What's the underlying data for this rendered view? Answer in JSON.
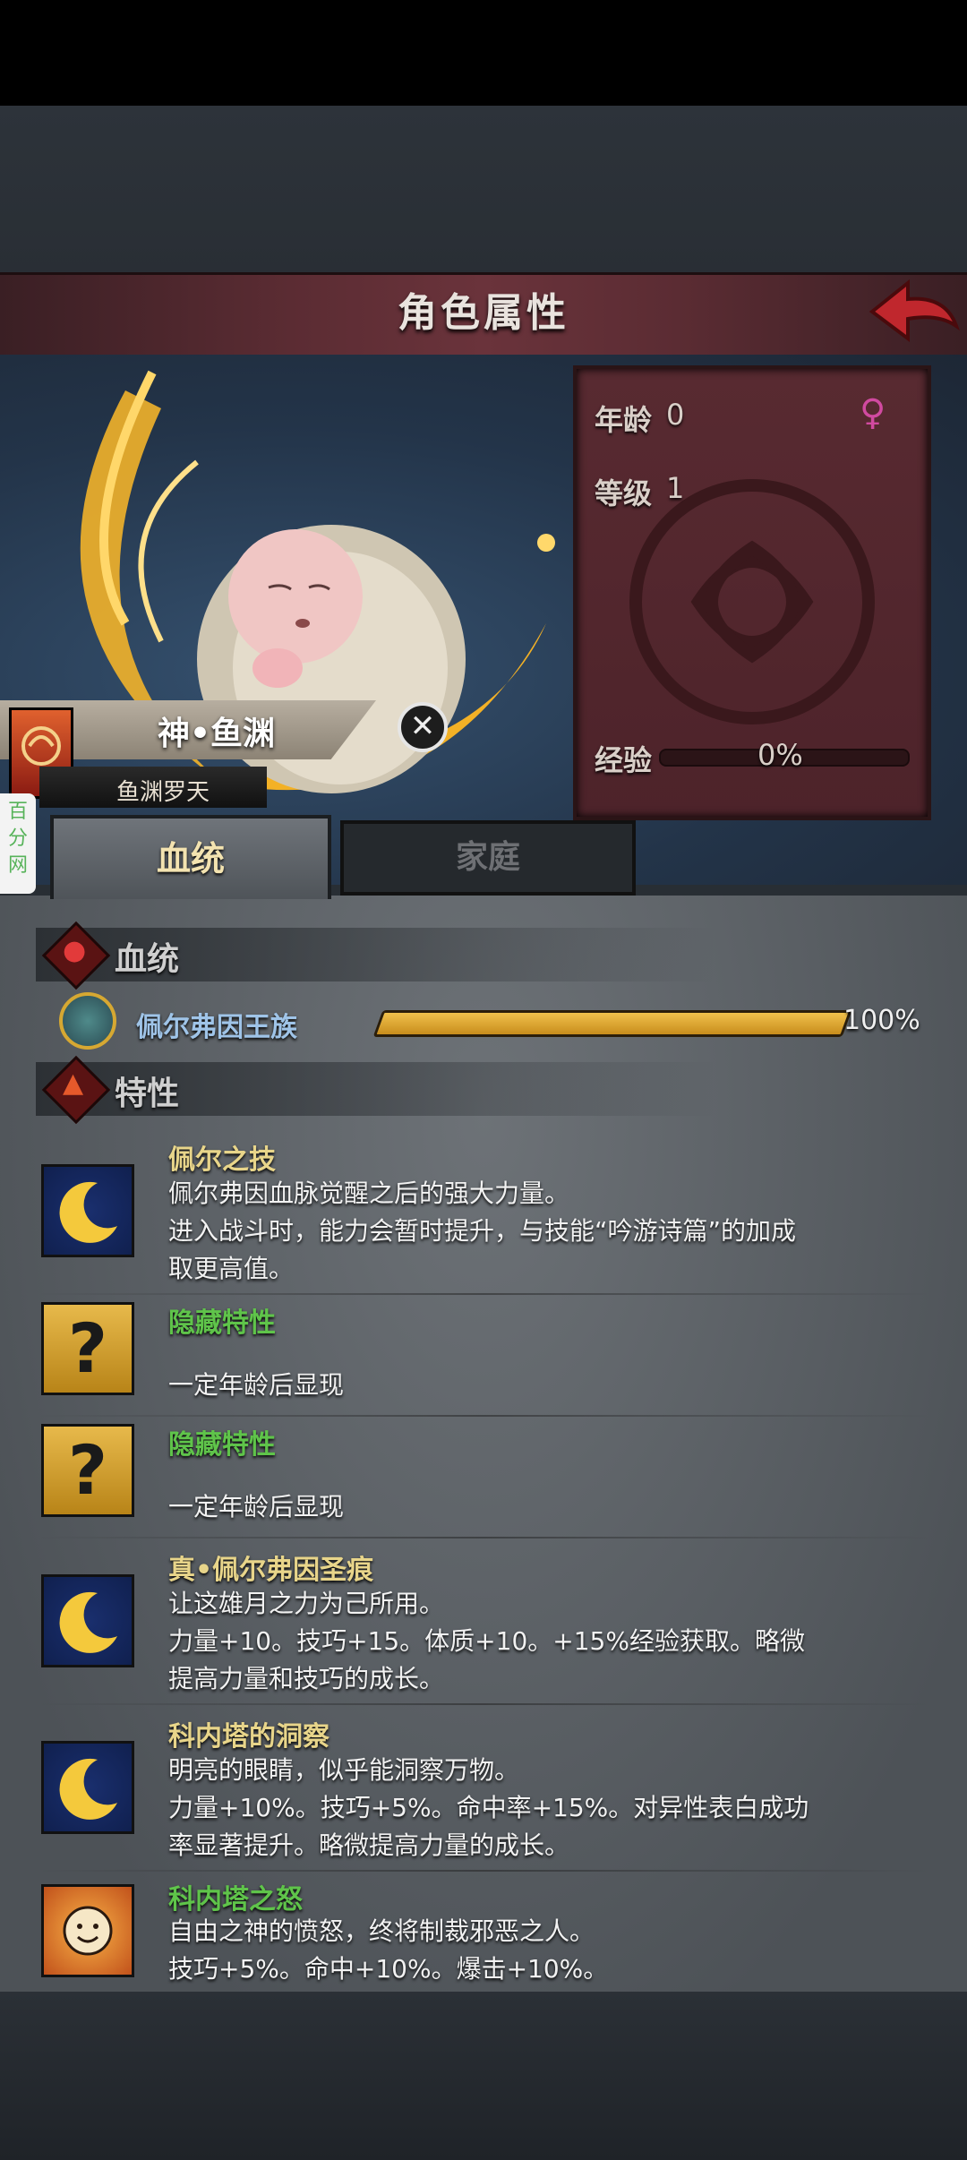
{
  "header": {
    "title": "角色属性"
  },
  "character": {
    "name": "神•鱼渊",
    "subtitle": "鱼渊罗天",
    "stats": {
      "age_label": "年龄",
      "age_value": "0",
      "level_label": "等级",
      "level_value": "1",
      "exp_label": "经验",
      "exp_value": "0%",
      "exp_fraction": 0.0
    }
  },
  "watermark": "百分网",
  "tabs": [
    {
      "label": "血统",
      "active": true
    },
    {
      "label": "家庭",
      "active": false
    }
  ],
  "lineage": {
    "section_title": "血统",
    "name": "佩尔弗因王族",
    "percent_text": "100%",
    "fraction": 1.0
  },
  "traits": {
    "section_title": "特性",
    "items": [
      {
        "icon": "crescent-moon-icon",
        "name": "佩尔之技",
        "name_color": "#e8d58a",
        "desc": "佩尔弗因血脉觉醒之后的强大力量。\n进入战斗时，能力会暂时提升，与技能“吟游诗篇”的加成\n取更高值。"
      },
      {
        "icon": "question-mark-icon",
        "name": "隐藏特性",
        "name_color": "#5fc44a",
        "desc": "一定年龄后显现"
      },
      {
        "icon": "question-mark-icon",
        "name": "隐藏特性",
        "name_color": "#5fc44a",
        "desc": "一定年龄后显现"
      },
      {
        "icon": "crescent-moon-icon",
        "name": "真•佩尔弗因圣痕",
        "name_color": "#e8d58a",
        "desc": "让这雄月之力为己所用。\n力量+10。技巧+15。体质+10。+15%经验获取。略微\n提高力量和技巧的成长。"
      },
      {
        "icon": "crescent-moon-icon",
        "name": "科内塔的洞察",
        "name_color": "#e8d58a",
        "desc": "明亮的眼睛，似乎能洞察万物。\n力量+10%。技巧+5%。命中率+15%。对异性表白成功\n率显著提升。略微提高力量的成长。"
      },
      {
        "icon": "smiling-sun-icon",
        "name": "科内塔之怒",
        "name_color": "#5fc44a",
        "desc": "自由之神的愤怒，终将制裁邪恶之人。\n技巧+5%。命中+10%。爆击+10%。"
      }
    ]
  }
}
